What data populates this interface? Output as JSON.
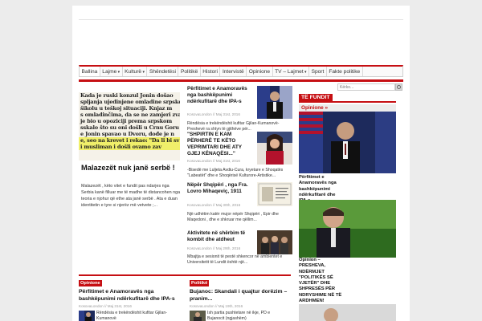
{
  "nav": {
    "items": [
      {
        "label": "Ballina",
        "dropdown": false,
        "active": true
      },
      {
        "label": "Lajme",
        "dropdown": true
      },
      {
        "label": "Kulturë",
        "dropdown": true
      },
      {
        "label": "Shëndetësi",
        "dropdown": false
      },
      {
        "label": "Politikë",
        "dropdown": false
      },
      {
        "label": "Histori",
        "dropdown": false
      },
      {
        "label": "Intervistë",
        "dropdown": false
      },
      {
        "label": "Opinione",
        "dropdown": false
      },
      {
        "label": "TV – Lajmet",
        "dropdown": true
      },
      {
        "label": "Sport",
        "dropdown": false
      },
      {
        "label": "Fakte politike",
        "dropdown": false
      }
    ]
  },
  "search": {
    "placeholder": "Kërko..."
  },
  "featured": {
    "image_lines": [
      "Kada je ruski konzul Jonin došao",
      "spljanja ujedinjene omladine srpske,",
      "šikolu u teškoj situaciji. Knjaz m",
      "s omladinčima, da se ne zamjeri zvan",
      "je bio u opoziciji prema srpskom",
      "sskalo što su oni došli u Crnu Goru",
      "e Jonin spavao u Dvoru, dođe je n",
      "e, seo na krevet i rekao: \"Da li bi sv",
      "i musliman i došli ovamo zav"
    ],
    "title": "Malazezët nuk janë serbë !",
    "excerpt": "Malazezët , këto vitet e fundit pas ndarjes nga Serbia kanë filluar me të madhe të distancohen nga teoria e njohur që ethe ata janë serbë . Ata e duan identitetin e tyre si njerëz më vetvete ;..."
  },
  "mid": [
    {
      "title": "Përfitimet e Anamoravës nga bashkëpunimi ndërkufitarë dhe IPA-s",
      "meta": "KosovaLondon // Maj 31st, 2016",
      "excerpt": "Rëndësia e trekëndëshit kufitar Gjilan-Kumanovë-Preshevë ra shtyn të gjithëve për..."
    },
    {
      "title": "\"SHPIRTIN E KAM PËRHERË TE KËTO VEPRIMTARI DHE ATY GJEJ KËNAQËSI...\"",
      "meta": "KosovaLondon // Maj 31st, 2016",
      "excerpt": "-Bisedë me Luljeta Avdiu-Cura, kryetare e Shoqatës \"Labeatët\" dhe e Shoqërisë Kulturore-Artistike..."
    },
    {
      "title": "Nëpër Shqipëri , nga Fra. Lovro Mihaqeviç, 1911",
      "meta": "KosovaLondon // Maj 30th, 2016",
      "excerpt": "Një udhëtim katër mujor nëpër Shqipëri , Epir dhe Maqedoni , dhe e shkruar me qëllim..."
    },
    {
      "title": "Aktivitete në shërbim të kombit dhe atdheut",
      "meta": "KosovaLondon // Maj 29th, 2016",
      "excerpt": "Mbajtja e sesionit të pestë shkencor në ambientet e Universitetit të Lundit është një..."
    }
  ],
  "sidebar": {
    "header": "TË FUNDIT",
    "sub": "Opinione »",
    "item1_title": "Përfitimet e Anamoravës nga bashkëpunimi ndërkufitarë dhe IPA-s",
    "item2_title": "Opinion – PRESHEVA, NDËRMJET \"POLITIKËS SË VJETËR\" DHE SHPRESËS PËR NDRYSHIME NË TË ARDHMEN!"
  },
  "bottom": [
    {
      "category": "Opinione",
      "title": "Përfitimet e Anamoravës nga bashkëpunimi ndërkufitarë dhe IPA-s",
      "meta": "KosovaLondon // Maj 31st, 2016",
      "excerpt": "Rëndësia e trekëndëshit kufitar Gjilan-Kumanovë"
    },
    {
      "category": "Politikë",
      "title": "Bujanoc: Skandali i quajtur dorëzim – pranim...",
      "meta": "KosovaLondon // Maj 19th, 2016",
      "excerpt": "Ish partia pushtetare në ikje, PD e Bujanocit (ngjashëm)"
    }
  ],
  "colors": {
    "accent": "#c60f13",
    "highlight": "#f0ef6a"
  }
}
